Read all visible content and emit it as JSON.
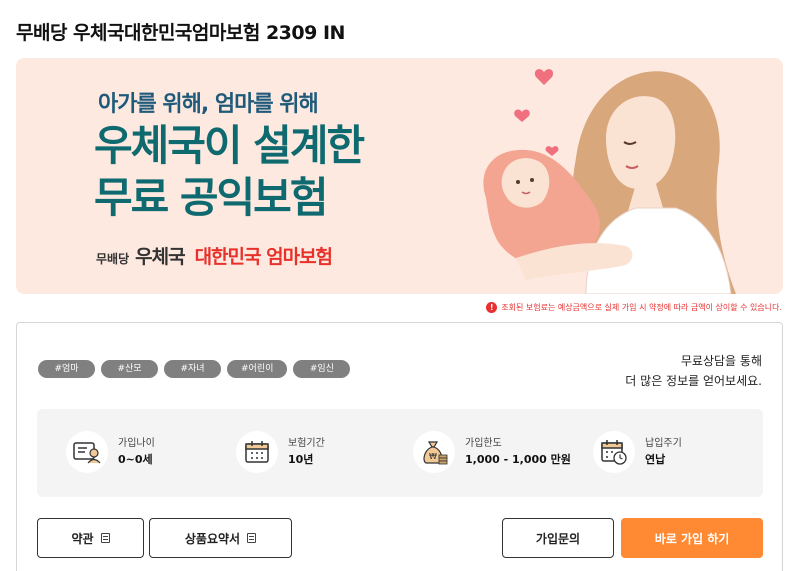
{
  "page": {
    "title": "무배당 우체국대한민국엄마보험 2309 IN"
  },
  "banner": {
    "subtitle": "아가를 위해, 엄마를 위해",
    "headline_line1": "우체국이 설계한",
    "headline_line2": "무료 공익보험",
    "brand_prefix": "무배당",
    "brand_post": "우체국",
    "brand_product": "대한민국 엄마보험"
  },
  "notice": {
    "icon": "!",
    "text": "조회된 보험료는 예상금액으로 실제 가입 시 약정에 따라 금액이 상이할 수 있습니다."
  },
  "tags": [
    "#엄마",
    "#산모",
    "#자녀",
    "#어린이",
    "#임신"
  ],
  "consult": {
    "line1": "무료상담을 통해",
    "line2": "더 많은 정보를 얻어보세요."
  },
  "info": [
    {
      "icon": "id-card-icon",
      "label": "가입나이",
      "value": "0~0세"
    },
    {
      "icon": "calendar-icon",
      "label": "보험기간",
      "value": "10년"
    },
    {
      "icon": "money-bag-icon",
      "label": "가입한도",
      "value": "1,000 - 1,000 만원"
    },
    {
      "icon": "calendar-clock-icon",
      "label": "납입주기",
      "value": "연납"
    }
  ],
  "buttons": {
    "terms": "약관",
    "summary": "상품요약서",
    "inquiry": "가입문의",
    "join": "바로 가입 하기"
  },
  "colors": {
    "accent": "#ff8a33",
    "banner_bg": "#fde9e0",
    "headline": "#0f6a70",
    "brand_red": "#e8312a",
    "tag_bg": "#808080",
    "notice": "#e83030"
  }
}
